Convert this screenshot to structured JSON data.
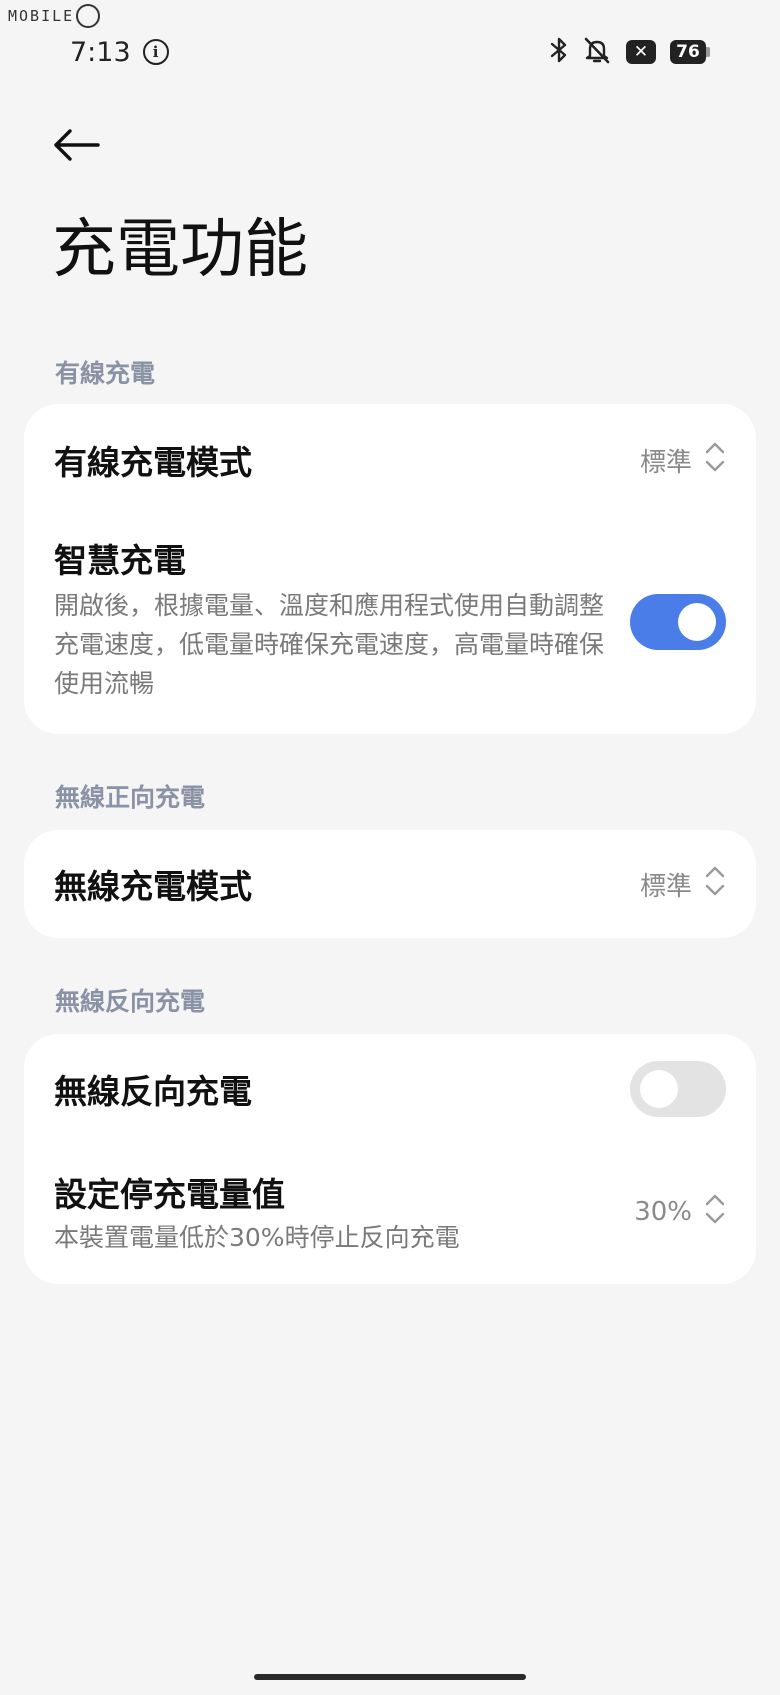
{
  "watermark": {
    "text": "MOBILE"
  },
  "status_bar": {
    "time": "7:13",
    "battery_level": "76",
    "notification_badge": "✕"
  },
  "page": {
    "title": "充電功能"
  },
  "wired": {
    "section_label": "有線充電",
    "mode_title": "有線充電模式",
    "mode_value": "標準",
    "smart_title": "智慧充電",
    "smart_desc": "開啟後，根據電量、溫度和應用程式使用自動調整充電速度，低電量時確保充電速度，高電量時確保使用流暢",
    "smart_enabled": true
  },
  "wireless_forward": {
    "section_label": "無線正向充電",
    "mode_title": "無線充電模式",
    "mode_value": "標準"
  },
  "wireless_reverse": {
    "section_label": "無線反向充電",
    "toggle_title": "無線反向充電",
    "toggle_enabled": false,
    "stop_title": "設定停充電量值",
    "stop_desc": "本裝置電量低於30%時停止反向充電",
    "stop_value": "30%"
  },
  "colors": {
    "accent": "#4a7de8",
    "background": "#f5f5f5",
    "card": "#ffffff",
    "section_label": "#8a92a6"
  }
}
